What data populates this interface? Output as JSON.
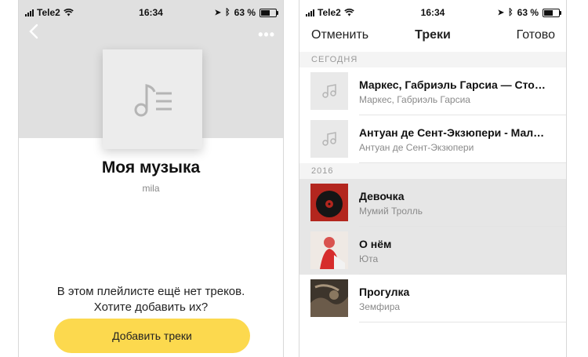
{
  "status_left": {
    "carrier": "Tele2",
    "time": "16:34",
    "battery": "63 %"
  },
  "status_right": {
    "carrier": "Tele2",
    "time": "16:34",
    "battery": "63 %"
  },
  "playlist": {
    "title": "Моя музыка",
    "owner": "mila",
    "empty_line1": "В этом плейлисте ещё нет треков.",
    "empty_line2": "Хотите добавить их?",
    "add_button": "Добавить треки"
  },
  "picker": {
    "cancel": "Отменить",
    "title": "Треки",
    "done": "Готово",
    "sections": [
      {
        "header": "СЕГОДНЯ",
        "tracks": [
          {
            "title": "Маркес, Габриэль Гарсиа — Сто…",
            "artist": "Маркес, Габриэль Гарсиа",
            "cover": "note-icon",
            "selected": false
          },
          {
            "title": "Антуан де Сент-Экзюпери - Мал…",
            "artist": "Антуан де Сент-Экзюпери",
            "cover": "note-icon",
            "selected": false
          }
        ]
      },
      {
        "header": "2016",
        "tracks": [
          {
            "title": "Девочка",
            "artist": "Мумий Тролль",
            "cover": "album-art",
            "selected": true
          },
          {
            "title": "О нём",
            "artist": "Юта",
            "cover": "album-art",
            "selected": true
          },
          {
            "title": "Прогулка",
            "artist": "Земфира",
            "cover": "album-art",
            "selected": false
          }
        ]
      }
    ]
  },
  "colors": {
    "accent": "#fcd94e",
    "header_gray": "#e0e0e0",
    "selected_row": "#e6e6e6"
  }
}
